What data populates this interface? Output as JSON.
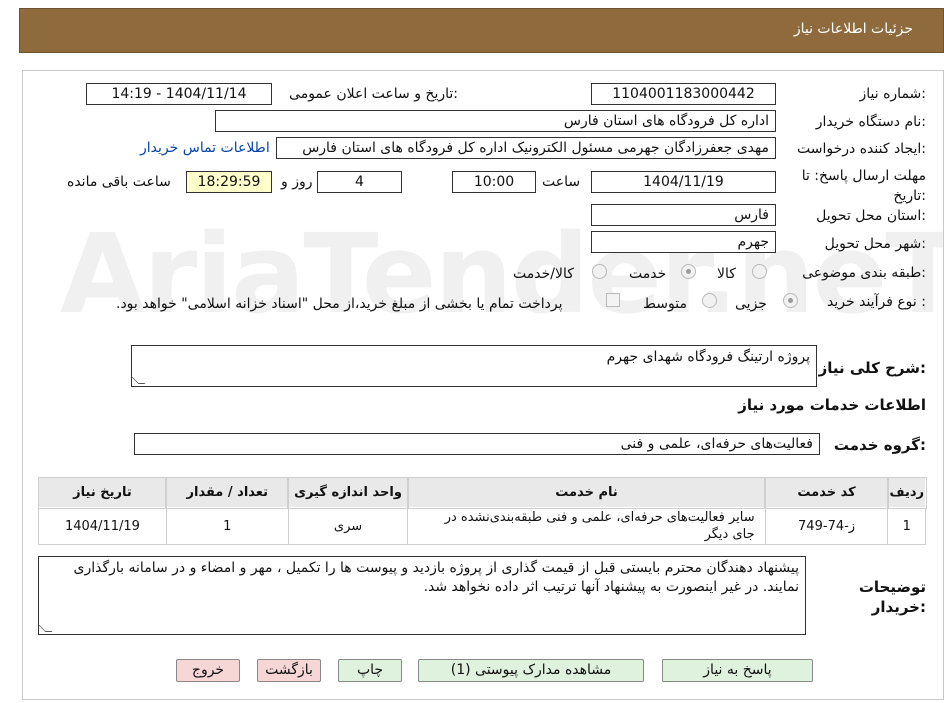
{
  "header": {
    "title": "جزئیات اطلاعات نیاز"
  },
  "watermark": {
    "text": "AriaTender.neT"
  },
  "form": {
    "need_number_label": "شماره نیاز:",
    "need_number": "1104001183000442",
    "announce_label": "تاریخ و ساعت اعلان عمومی:",
    "announce_value": "1404/11/14 - 14:19",
    "buyer_org_label": "نام دستگاه خریدار:",
    "buyer_org": "اداره کل فرودگاه های استان فارس",
    "creator_label": "ایجاد کننده درخواست:",
    "creator": "مهدی جعفرزادگان جهرمی مسئول الکترونیک اداره کل فرودگاه های استان فارس",
    "contact_link": "اطلاعات تماس خریدار",
    "deadline_label": "مهلت ارسال پاسخ: تا تاریخ:",
    "deadline_date": "1404/11/19",
    "time_label": "ساعت",
    "deadline_time": "10:00",
    "days_value": "4",
    "days_label": "روز و",
    "remaining_time": "18:29:59",
    "remaining_label": "ساعت باقی مانده",
    "province_label": "استان محل تحویل:",
    "province": "فارس",
    "city_label": "شهر محل تحویل:",
    "city": "جهرم",
    "category_label": "طبقه بندی موضوعی:",
    "category_options": [
      "کالا",
      "خدمت",
      "کالا/خدمت"
    ],
    "category_selected": "خدمت",
    "process_label": "نوع فرآیند خرید :",
    "process_options": [
      "جزیی",
      "متوسط"
    ],
    "process_selected": "جزیی",
    "payment_note": "پرداخت تمام یا بخشی از مبلغ خرید،از محل \"اسناد خزانه اسلامی\" خواهد بود."
  },
  "summary": {
    "label": "شرح کلی نیاز:",
    "value": "پروژه ارتینگ فرودگاه شهدای جهرم"
  },
  "services_section": {
    "title": "اطلاعات خدمات مورد نیاز",
    "group_label": "گروه خدمت:",
    "group_value": "فعالیت‌های حرفه‌ای، علمی و فنی"
  },
  "table": {
    "headers": [
      "ردیف",
      "کد خدمت",
      "نام خدمت",
      "واحد اندازه گیری",
      "تعداد / مقدار",
      "تاریخ نیاز"
    ],
    "rows": [
      [
        "1",
        "ز-74-749",
        "سایر فعالیت‌های حرفه‌ای، علمی و فنی طبقه‌بندی‌نشده در جای دیگر",
        "سری",
        "1",
        "1404/11/19"
      ]
    ]
  },
  "buyer_notes": {
    "label": "توضیحات خریدار:",
    "line1": "پیشنهاد دهندگان محترم بایستی قبل از قیمت گذاری از پروژه بازدید و  پیوست ها را تکمیل ، مهر و امضاء و در سامانه بارگذاری",
    "line2": "نمایند. در غیر اینصورت به پیشنهاد آنها ترتیب اثر داده نخواهد شد."
  },
  "buttons": {
    "reply": "پاسخ به نیاز",
    "attachments": "مشاهده مدارک پیوستی (1)",
    "print": "چاپ",
    "back": "بازگشت",
    "exit": "خروج"
  }
}
